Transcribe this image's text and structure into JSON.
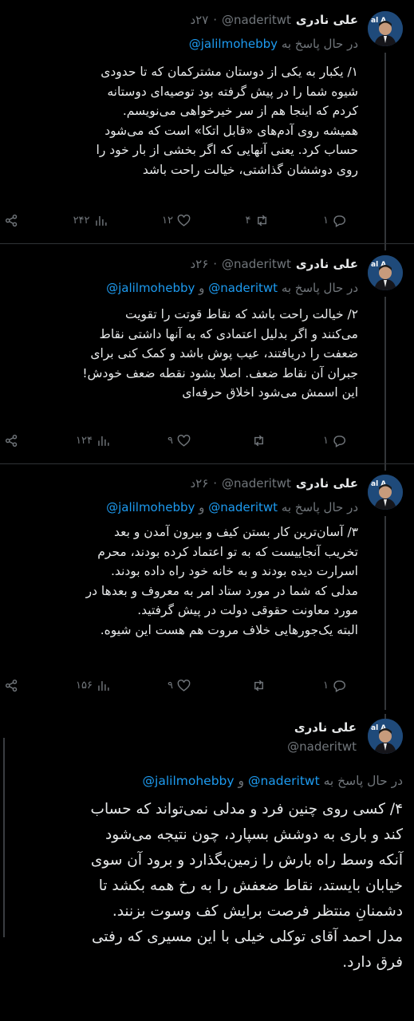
{
  "tweets": [
    {
      "name": "علی نادری",
      "handle": "@naderitwt",
      "time": "۲۷د",
      "reply_prefix": "در حال پاسخ به",
      "reply_to": [
        "@jalilmohebby"
      ],
      "reply_and": "",
      "lines": [
        "۱/ یکبار به یکی از دوستان مشترکمان که تا حدودی",
        "شیوه شما را در پیش گرفته بود توصیه‌ای دوستانه",
        "کردم که اینجا هم از سر خیرخواهی می‌نویسم.",
        "همیشه روی آدم‌های «قابل اتکا» است که می‌شود",
        "حساب کرد. یعنی آنهایی که اگر بخشی از بار خود را",
        "روی دوششان گذاشتی، خیالت راحت باشد"
      ],
      "replies": "۱",
      "retweets": "۴",
      "likes": "۱۲",
      "views": "۲۴۲"
    },
    {
      "name": "علی نادری",
      "handle": "@naderitwt",
      "time": "۲۶د",
      "reply_prefix": "در حال پاسخ به",
      "reply_to": [
        "@naderitwt",
        "@jalilmohebby"
      ],
      "reply_and": "و",
      "lines": [
        "۲/ خیالت راحت باشد که نقاط قوتت را تقویت",
        "می‌کنند و اگر بدلیل اعتمادی که به آنها داشتی نقاط",
        "ضعفت را دریافتند، عیب پوش باشد و کمک کنی برای",
        "جبران آن نقاط ضعف. اصلا بشود نقطه ضعف خودش!",
        "این اسمش می‌شود اخلاق حرفه‌ای"
      ],
      "replies": "۱",
      "retweets": "",
      "likes": "۹",
      "views": "۱۲۴"
    },
    {
      "name": "علی نادری",
      "handle": "@naderitwt",
      "time": "۲۶د",
      "reply_prefix": "در حال پاسخ به",
      "reply_to": [
        "@naderitwt",
        "@jalilmohebby"
      ],
      "reply_and": "و",
      "lines": [
        "۳/ آسان‌ترین کار بستن کیف و بیرون آمدن و بعد",
        "تخریب آنجاییست که به تو اعتماد کرده بودند، محرم",
        "اسرارت دیده بودند و به خانه خود راه داده بودند.",
        "مدلی که شما در مورد ستاد امر به معروف و بعدها در",
        "مورد معاونت حقوقی دولت در پیش گرفتید.",
        "البته یک‌جورهایی خلاف مروت هم هست این شیوه."
      ],
      "replies": "۱",
      "retweets": "",
      "likes": "۹",
      "views": "۱۵۶"
    }
  ],
  "main_tweet": {
    "name": "علی نادری",
    "handle": "@naderitwt",
    "reply_prefix": "در حال پاسخ به",
    "reply_to": [
      "@naderitwt",
      "@jalilmohebby"
    ],
    "reply_and": "و",
    "lines": [
      "۴/ کسی روی چنین فرد و مدلی نمی‌تواند که حساب",
      "کند و باری به دوشش بسپارد، چون نتیجه می‌شود",
      "آنکه وسط راه بارش را زمین‌بگذارد و برود آن سوی",
      "خیابان بایستد، نقاط ضعفش را به رخ همه بکشد تا",
      "دشمنانِ منتظر فرصت برایش کف وسوت بزنند.",
      "مدل احمد آقای توکلی خیلی با این مسیری که رفتی",
      "فرق دارد."
    ]
  },
  "colors": {
    "background": "#000000",
    "text": "#e7e9ea",
    "muted": "#71767b",
    "link": "#1d9bf0",
    "separator": "#2f3336"
  },
  "icons": [
    "reply-icon",
    "retweet-icon",
    "like-icon",
    "views-icon",
    "share-icon"
  ]
}
